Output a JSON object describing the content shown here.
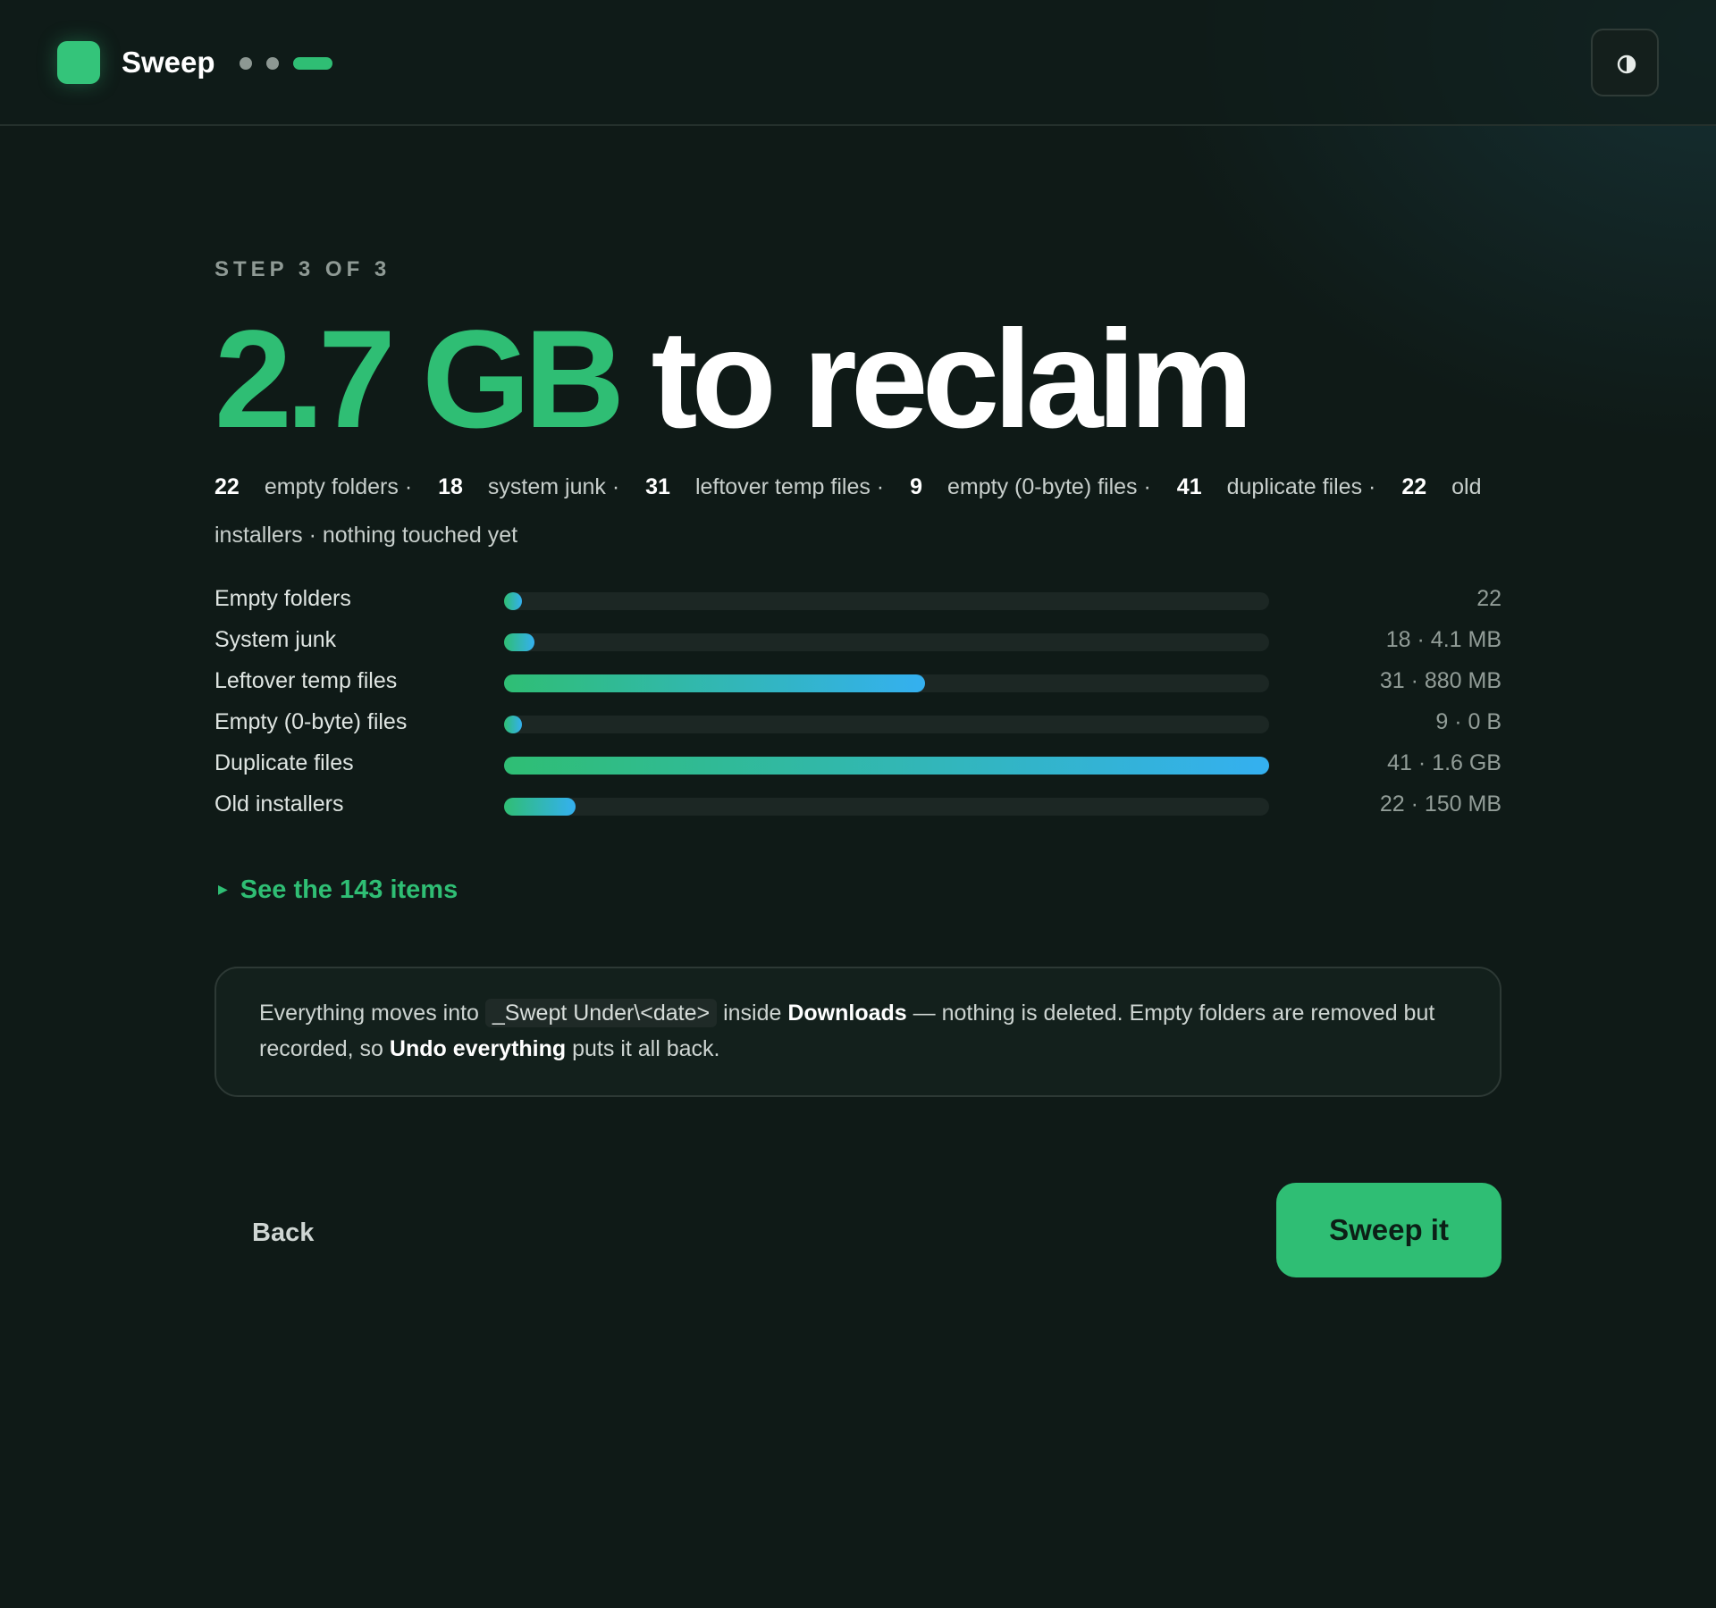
{
  "header": {
    "app_name": "Sweep",
    "icons": {
      "logo": "app-logo-tile",
      "theme": "contrast-half-circle-icon"
    },
    "progress": {
      "current_step": 3,
      "total_steps": 3
    }
  },
  "colors": {
    "accent": "#2fbe74",
    "gradient_end": "#34b0f0",
    "background": "#0f1a17"
  },
  "main": {
    "step_label": "STEP 3 OF 3",
    "headline_amount": "2.7 GB",
    "headline_rest": "to reclaim",
    "summary": {
      "items": [
        {
          "count": "22",
          "text": "empty folders ·"
        },
        {
          "count": "18",
          "text": "system junk ·"
        },
        {
          "count": "31",
          "text": "leftover temp files ·"
        },
        {
          "count": "9",
          "text": "empty (0-byte) files ·"
        },
        {
          "count": "41",
          "text": "duplicate files ·"
        },
        {
          "count": "22",
          "text": "old installers · nothing touched yet"
        }
      ]
    },
    "breakdown": [
      {
        "label": "Empty folders",
        "value": "22",
        "fill_fraction": 0.02
      },
      {
        "label": "System junk",
        "value": "18 · 4.1 MB",
        "fill_fraction": 0.04
      },
      {
        "label": "Leftover temp files",
        "value": "31 · 880 MB",
        "fill_fraction": 0.55
      },
      {
        "label": "Empty (0-byte) files",
        "value": "9 · 0 B",
        "fill_fraction": 0.02
      },
      {
        "label": "Duplicate files",
        "value": "41 · 1.6 GB",
        "fill_fraction": 1.0
      },
      {
        "label": "Old installers",
        "value": "22 · 150 MB",
        "fill_fraction": 0.094
      }
    ],
    "see_items": "See the 143 items",
    "notice": {
      "part1": "Everything moves into ",
      "code": "_Swept Under\\<date>",
      "part2": " inside ",
      "bold1": "Downloads",
      "part3": " — nothing is deleted. Empty folders are removed but recorded, so ",
      "bold2": "Undo everything",
      "part4": " puts it all back."
    }
  },
  "footer": {
    "back_label": "Back",
    "sweep_label": "Sweep it"
  }
}
